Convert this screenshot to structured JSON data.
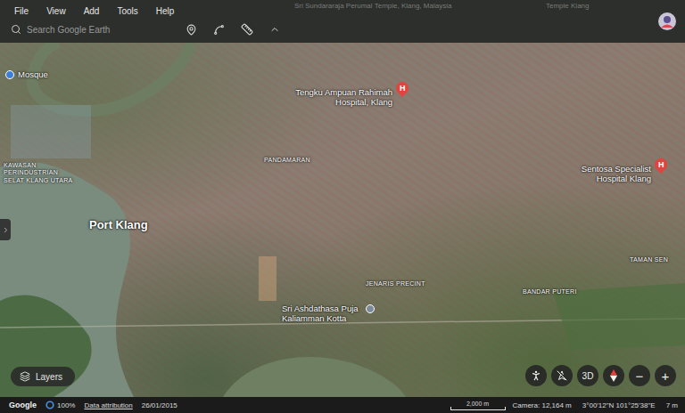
{
  "menu": [
    "File",
    "View",
    "Add",
    "Tools",
    "Help"
  ],
  "search": {
    "placeholder": "Search Google Earth"
  },
  "map_labels": [
    {
      "text": "Sri Sundararaja Perumal Temple, Klang, Malaysia",
      "kind": "faded"
    },
    {
      "text": "Temple Klang",
      "kind": "faded"
    },
    {
      "text": "Mosque",
      "kind": "mosque"
    },
    {
      "text": "KAWASAN PERINDUSTRIAN SELAT KLANG UTARA",
      "kind": "area"
    },
    {
      "text": "Tengku Ampuan Rahimah Hospital, Klang",
      "kind": "hospital",
      "icon": "H"
    },
    {
      "text": "PANDAMARAN",
      "kind": "area"
    },
    {
      "text": "Port Klang",
      "kind": "city"
    },
    {
      "text": "Sentosa Specialist Hospital Klang",
      "kind": "hospital",
      "icon": "H"
    },
    {
      "text": "TAMAN SEN",
      "kind": "area"
    },
    {
      "text": "JENARIS PRECINT",
      "kind": "area"
    },
    {
      "text": "BANDAR PUTERI",
      "kind": "area"
    },
    {
      "text": "Sri Ashdathasa Puja Kaliamman Kotta",
      "kind": "temple"
    }
  ],
  "layers_button": {
    "label": "Layers"
  },
  "view_controls": {
    "three_d": "3D",
    "zoom_out": "−",
    "zoom_in": "+"
  },
  "status_bar": {
    "logo": "Google",
    "loading": "100%",
    "attribution": "Data attribution",
    "date": "26/01/2015",
    "scale": "2,000 m",
    "camera": "Camera: 12,164 m",
    "coordinates": "3°00'12\"N 101°25'38\"E",
    "elevation": "7 m"
  }
}
